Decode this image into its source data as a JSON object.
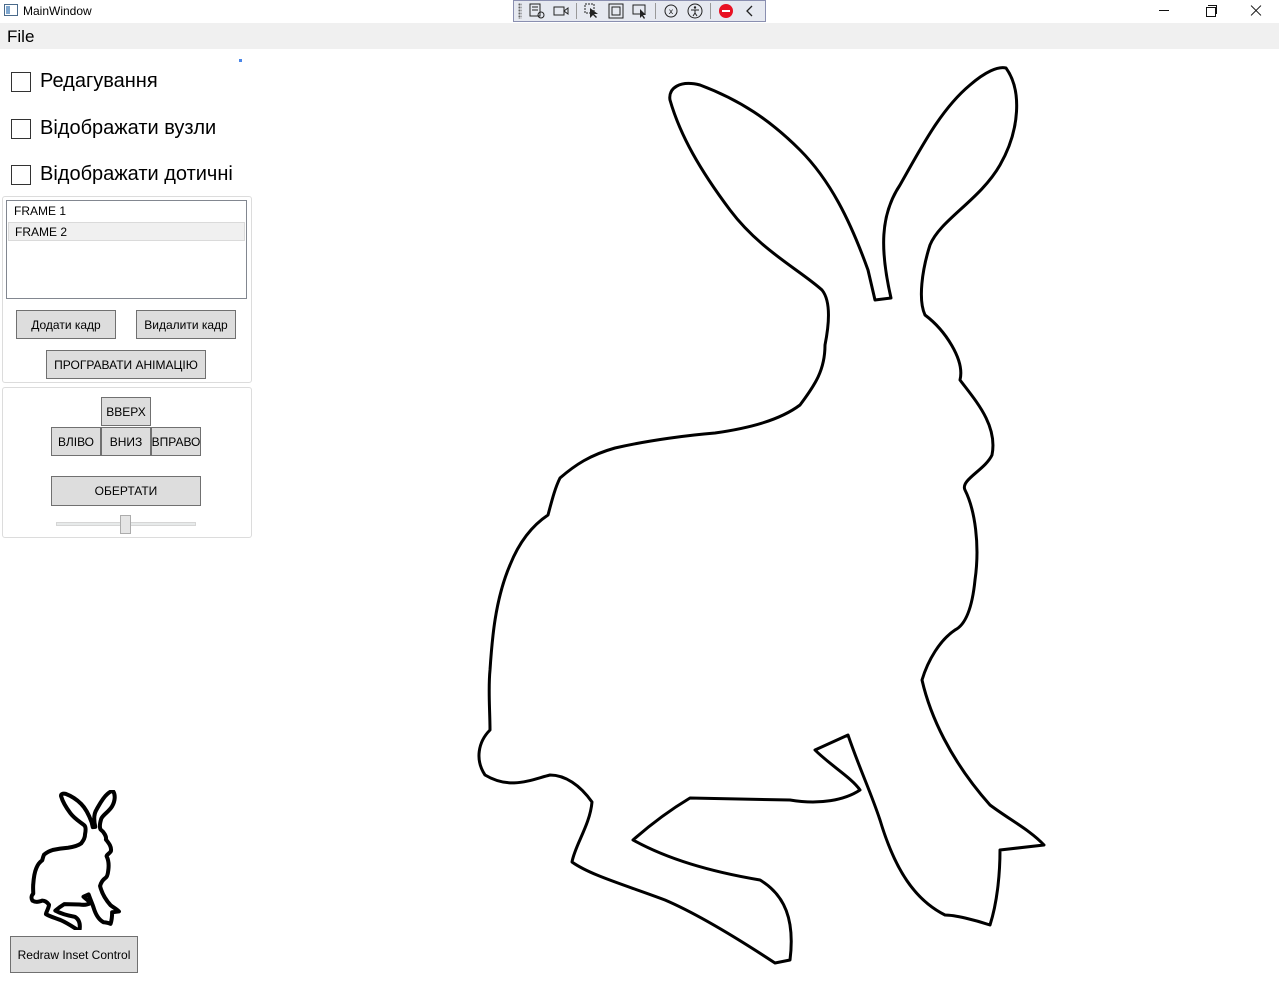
{
  "window": {
    "title": "MainWindow"
  },
  "devbar": {
    "icons": [
      "select-element-icon",
      "video-icon",
      "pointer-icon",
      "frame-icon",
      "track-focus-icon",
      "binding-icon",
      "accessibility-icon",
      "stop-icon",
      "collapse-chevron-icon"
    ]
  },
  "menu": {
    "file": "File"
  },
  "options": {
    "edit": "Редагування",
    "show_nodes": "Відображати вузли",
    "show_tangents": "Відображати дотичні"
  },
  "frames": {
    "items": [
      "FRAME 1",
      "FRAME 2"
    ],
    "selected": "FRAME 2",
    "add_button": "Додати кадр",
    "delete_button": "Видалити кадр",
    "play_button": "ПРОГРАВАТИ АНІМАЦІЮ"
  },
  "transform": {
    "up": "ВВЕРХ",
    "left": "ВЛІВО",
    "down": "ВНИЗ",
    "right": "ВПРАВО",
    "rotate": "ОБЕРТАТИ",
    "rotation_slider_fraction": 0.46
  },
  "inset": {
    "redraw_button": "Redraw Inset Control"
  },
  "colors": {
    "menu_bg": "#f0f0f0",
    "button_bg": "#dddddd",
    "accent_stop": "#e81123",
    "outline": "#000000"
  }
}
